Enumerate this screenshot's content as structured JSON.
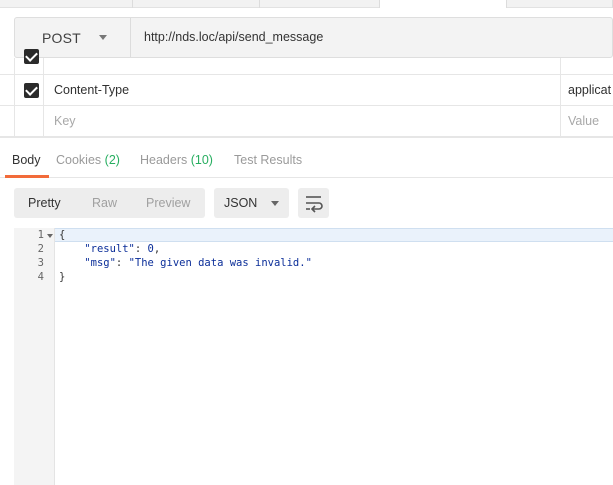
{
  "request": {
    "method": "POST",
    "url": "http://nds.loc/api/send_message"
  },
  "headers": {
    "rows": [
      {
        "key": "Content-Type",
        "value": "applicat",
        "checked": true
      }
    ],
    "placeholder": {
      "key": "Key",
      "value": "Value"
    }
  },
  "response_tabs": {
    "body": "Body",
    "cookies": "Cookies",
    "cookies_count": "(2)",
    "headers": "Headers",
    "headers_count": "(10)",
    "tests": "Test Results"
  },
  "toolbar": {
    "pretty": "Pretty",
    "raw": "Raw",
    "preview": "Preview",
    "format": "JSON",
    "wrap_icon": "wrap-lines-icon"
  },
  "code": {
    "line_numbers": [
      "1",
      "2",
      "3",
      "4"
    ],
    "line1": "{",
    "key1": "\"result\"",
    "sep1": ": ",
    "val1": "0",
    "comma1": ",",
    "key2": "\"msg\"",
    "sep2": ": ",
    "val2": "\"The given data was invalid.\"",
    "line4": "}"
  }
}
